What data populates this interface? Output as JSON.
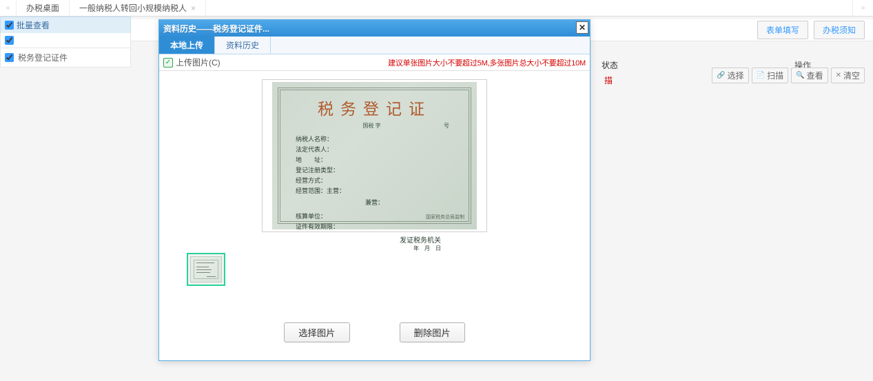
{
  "topbar": {
    "tabs": [
      {
        "label": "办税桌面",
        "closable": false
      },
      {
        "label": "一般纳税人转回小规模纳税人",
        "closable": true
      }
    ]
  },
  "toolbar": {
    "fill_btn": "表单填写",
    "notice_btn": "办税须知"
  },
  "left": {
    "batch_label": "批量查看",
    "items": [
      "税务登记证件"
    ]
  },
  "grid": {
    "status_header": "状态",
    "op_header": "操作",
    "status_red": "描"
  },
  "action_btns": {
    "select": "选择",
    "scan": "扫描",
    "view": "查看",
    "clear": "清空"
  },
  "modal": {
    "title": "资料历史——税务登记证件...",
    "tabs": [
      "本地上传",
      "资料历史"
    ],
    "upload_label": "上传图片(C)",
    "hint": "建议单张图片大小不要超过5M,多张图片总大小不要超过10M",
    "footer": {
      "select": "选择图片",
      "delete": "删除图片"
    }
  },
  "certificate": {
    "title": "税务登记证",
    "sub_left": "",
    "sub_center": "国税 字",
    "sub_right": "号",
    "fields": [
      "纳税人名称：",
      "法定代表人：",
      "地　　址：",
      "登记注册类型：",
      "经营方式：",
      "经营范围：主营："
    ],
    "center_line": "兼营：",
    "fields2": [
      "核算单位：",
      "证件有效期限："
    ],
    "authority": "发证税务机关",
    "date": "年　月　日",
    "footer": "国家税务总局监制"
  }
}
